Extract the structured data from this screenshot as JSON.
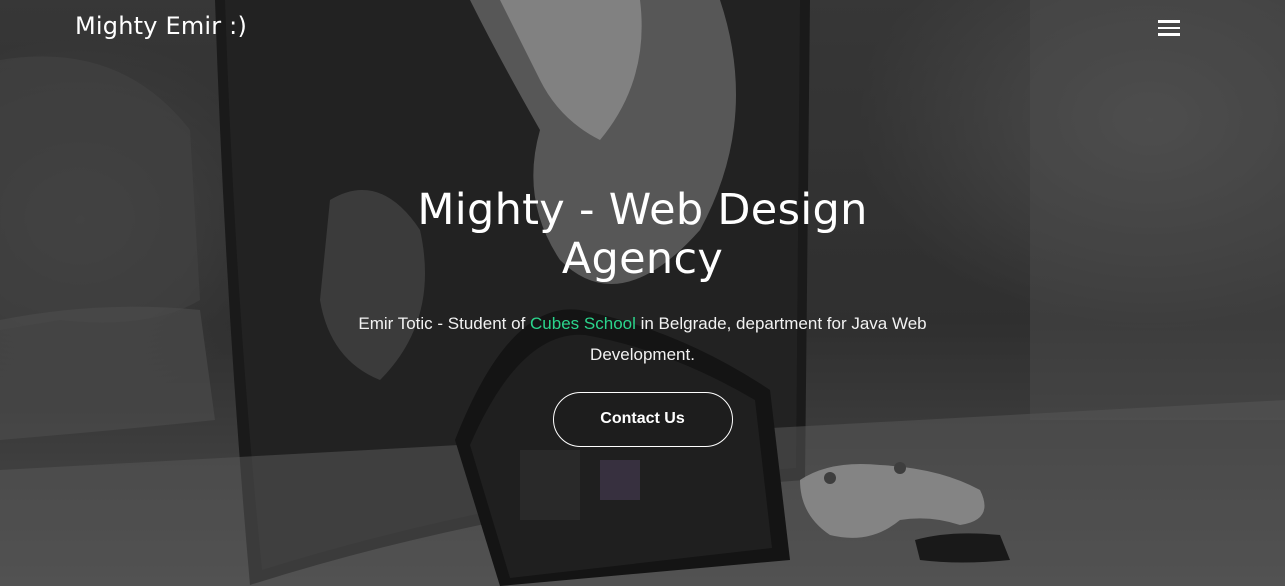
{
  "navbar": {
    "brand": "Mighty Emir :)",
    "menu_icon": "hamburger-menu-icon"
  },
  "hero": {
    "title": "Mighty - Web Design Agency",
    "subtitle_before": "Emir Totic - Student of ",
    "subtitle_link": "Cubes School",
    "subtitle_after": " in Belgrade, department for Java Web Development.",
    "cta_label": "Contact Us"
  },
  "colors": {
    "accent": "#2bd48c",
    "text": "#ffffff"
  }
}
